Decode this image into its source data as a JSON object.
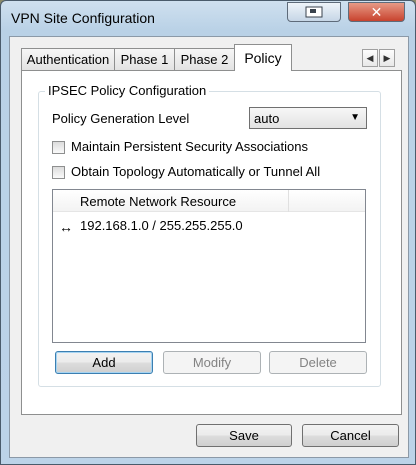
{
  "window": {
    "title": "VPN Site Configuration",
    "close_glyph": "✕"
  },
  "tabs": [
    {
      "label": "Authentication",
      "active": false
    },
    {
      "label": "Phase 1",
      "active": false
    },
    {
      "label": "Phase 2",
      "active": false
    },
    {
      "label": "Policy",
      "active": true
    }
  ],
  "tab_scroll": {
    "left_glyph": "◀",
    "right_glyph": "▶"
  },
  "policy": {
    "group_title": "IPSEC Policy Configuration",
    "generation_level_label": "Policy Generation Level",
    "generation_level_value": "auto",
    "persistent_sa_label": "Maintain Persistent Security Associations",
    "persistent_sa_checked": false,
    "obtain_topology_label": "Obtain Topology Automatically or Tunnel All",
    "obtain_topology_checked": false,
    "list_header": "Remote Network Resource",
    "resources": [
      {
        "icon": "↔",
        "value": "192.168.1.0 / 255.255.255.0"
      }
    ],
    "add_label": "Add",
    "modify_label": "Modify",
    "delete_label": "Delete"
  },
  "footer": {
    "save_label": "Save",
    "cancel_label": "Cancel"
  }
}
